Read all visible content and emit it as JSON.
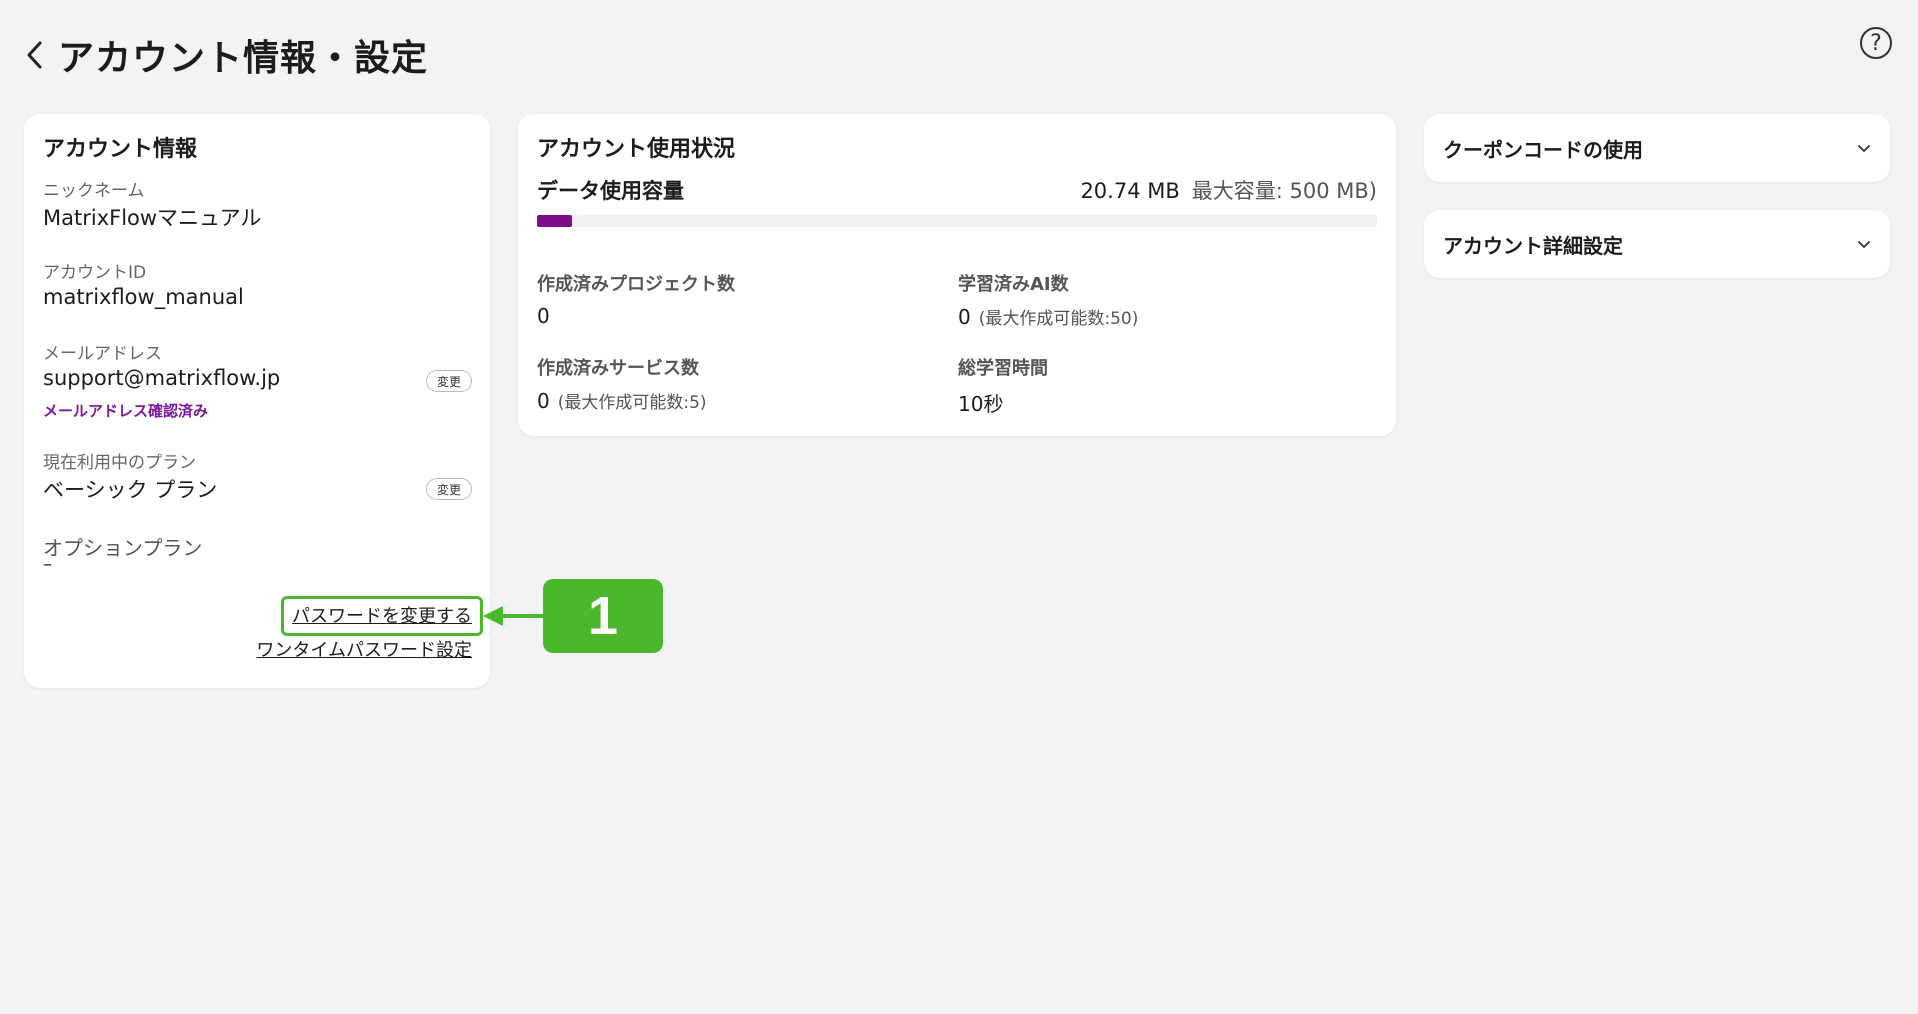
{
  "header": {
    "title": "アカウント情報・設定"
  },
  "account_card": {
    "title": "アカウント情報",
    "nickname_label": "ニックネーム",
    "nickname_value": "MatrixFlowマニュアル",
    "account_id_label": "アカウントID",
    "account_id_value": "matrixflow_manual",
    "email_label": "メールアドレス",
    "email_value": "support@matrixflow.jp",
    "email_change_btn": "変更",
    "email_verified": "メールアドレス確認済み",
    "plan_label": "現在利用中のプラン",
    "plan_value": "ベーシック プラン",
    "plan_change_btn": "変更",
    "option_label": "オプションプラン",
    "option_value": "–",
    "change_password_link": "パスワードを変更する",
    "otp_link": "ワンタイムパスワード設定"
  },
  "callout": {
    "number": "1"
  },
  "usage_card": {
    "title": "アカウント使用状況",
    "data_label": "データ使用容量",
    "data_used": "20.74 MB",
    "data_max": "最大容量: 500 MB)",
    "usage_fraction": 0.0415,
    "colors": {
      "progress_fill": "#7d0e8a",
      "progress_track": "#f0f0f2"
    },
    "projects_label": "作成済みプロジェクト数",
    "projects_value": "0",
    "trained_ai_label": "学習済みAI数",
    "trained_ai_value": "0",
    "trained_ai_sub": "(最大作成可能数:50)",
    "services_label": "作成済みサービス数",
    "services_value": "0",
    "services_sub": "(最大作成可能数:5)",
    "training_time_label": "総学習時間",
    "training_time_value": "10秒"
  },
  "right_panels": {
    "coupon": "クーポンコードの使用",
    "account_detail": "アカウント詳細設定"
  },
  "colors": {
    "accent_purple": "#7a1a9a",
    "annotation_green": "#4bb72b",
    "background": "#f3f3f5"
  }
}
